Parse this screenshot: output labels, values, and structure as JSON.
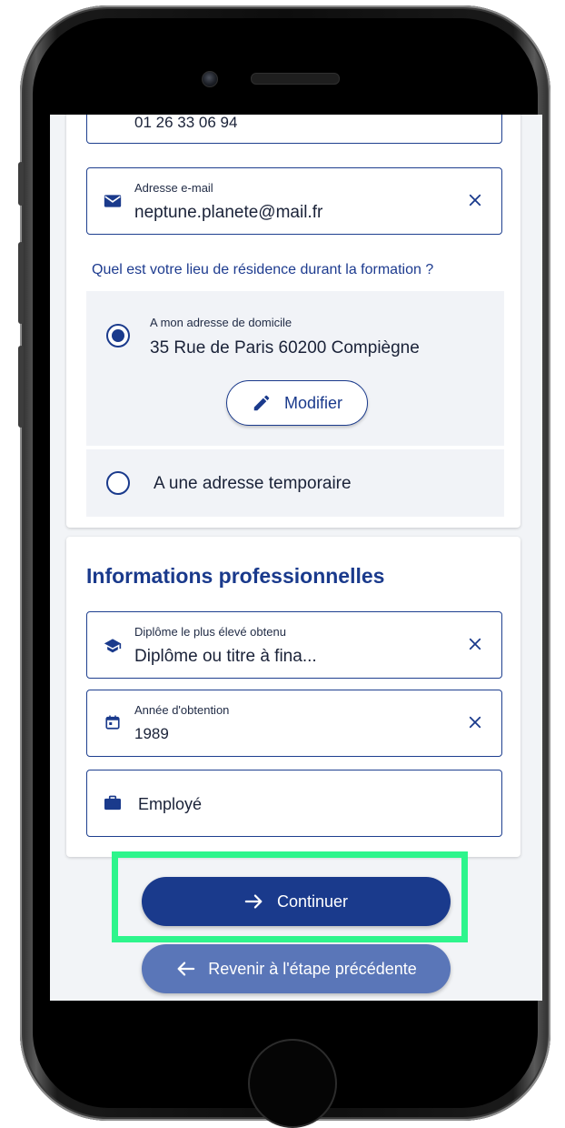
{
  "contact": {
    "phone_value": "01 26 33 06 94",
    "email_label": "Adresse e-mail",
    "email_value": "neptune.planete@mail.fr"
  },
  "residence": {
    "question": "Quel est votre lieu de résidence durant la formation ?",
    "home_option_label": "A mon adresse de domicile",
    "home_option_address": "35 Rue de Paris 60200 Compiègne",
    "modify_button": "Modifier",
    "temp_option_label": "A une adresse temporaire"
  },
  "professional": {
    "title": "Informations professionnelles",
    "diploma_label": "Diplôme le plus élevé obtenu",
    "diploma_value": "Diplôme ou titre à fina...",
    "year_label": "Année d'obtention",
    "year_value": "1989",
    "status_value": "Employé"
  },
  "actions": {
    "continue_label": "Continuer",
    "back_label": "Revenir à l'étape précédente"
  },
  "colors": {
    "primary": "#1a3a8c",
    "secondary_button": "#5a76b8",
    "highlight": "#2ef58c",
    "screen_bg": "#f2f4f7"
  }
}
